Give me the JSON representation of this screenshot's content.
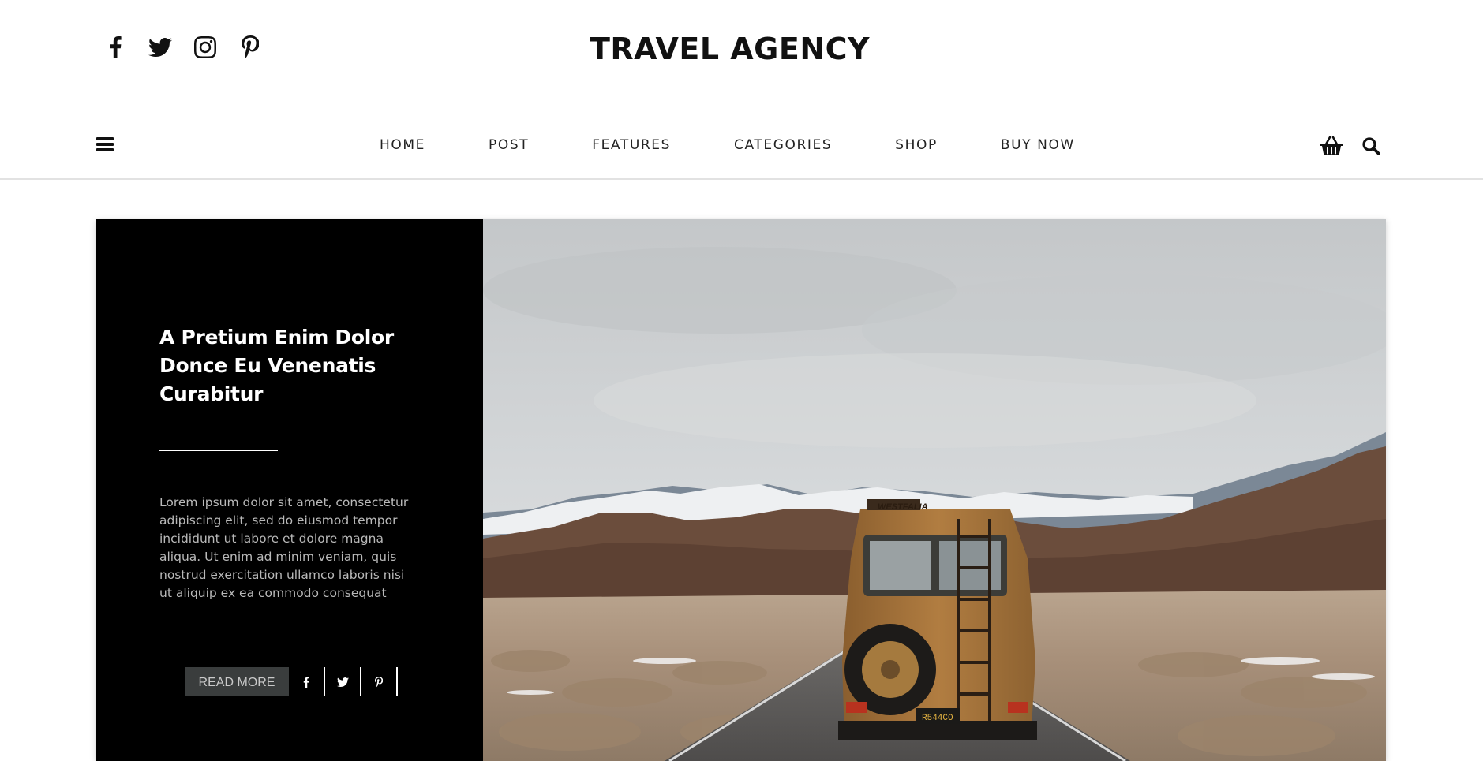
{
  "header": {
    "brand": "TRAVEL AGENCY",
    "socials": [
      {
        "icon": "facebook-icon"
      },
      {
        "icon": "twitter-icon"
      },
      {
        "icon": "instagram-icon"
      },
      {
        "icon": "pinterest-icon"
      }
    ]
  },
  "nav": {
    "items": [
      {
        "label": "HOME"
      },
      {
        "label": "POST"
      },
      {
        "label": "FEATURES"
      },
      {
        "label": "CATEGORIES"
      },
      {
        "label": "SHOP"
      },
      {
        "label": "BUY NOW"
      }
    ],
    "right_icons": [
      "basket-icon",
      "search-icon"
    ]
  },
  "hero": {
    "title": "A Pretium Enim Dolor Donce Eu Venenatis Curabitur",
    "excerpt": "Lorem ipsum dolor sit amet, consectetur adipiscing elit, sed do eiusmod tempor incididunt ut labore et dolore magna aliqua. Ut enim ad minim veniam, quis nostrud exercitation ullamco laboris nisi ut aliquip ex ea commodo consequat",
    "read_more": "READ MORE",
    "share_icons": [
      "facebook-icon",
      "twitter-icon",
      "pinterest-icon"
    ],
    "image": {
      "van_top_label": "WESTFALIA",
      "plate": "R544CO"
    }
  },
  "colors": {
    "panel_bg": "#000000",
    "button_bg": "#3a3d3d",
    "nav_text": "#222222",
    "divider": "#e2e2e2"
  }
}
